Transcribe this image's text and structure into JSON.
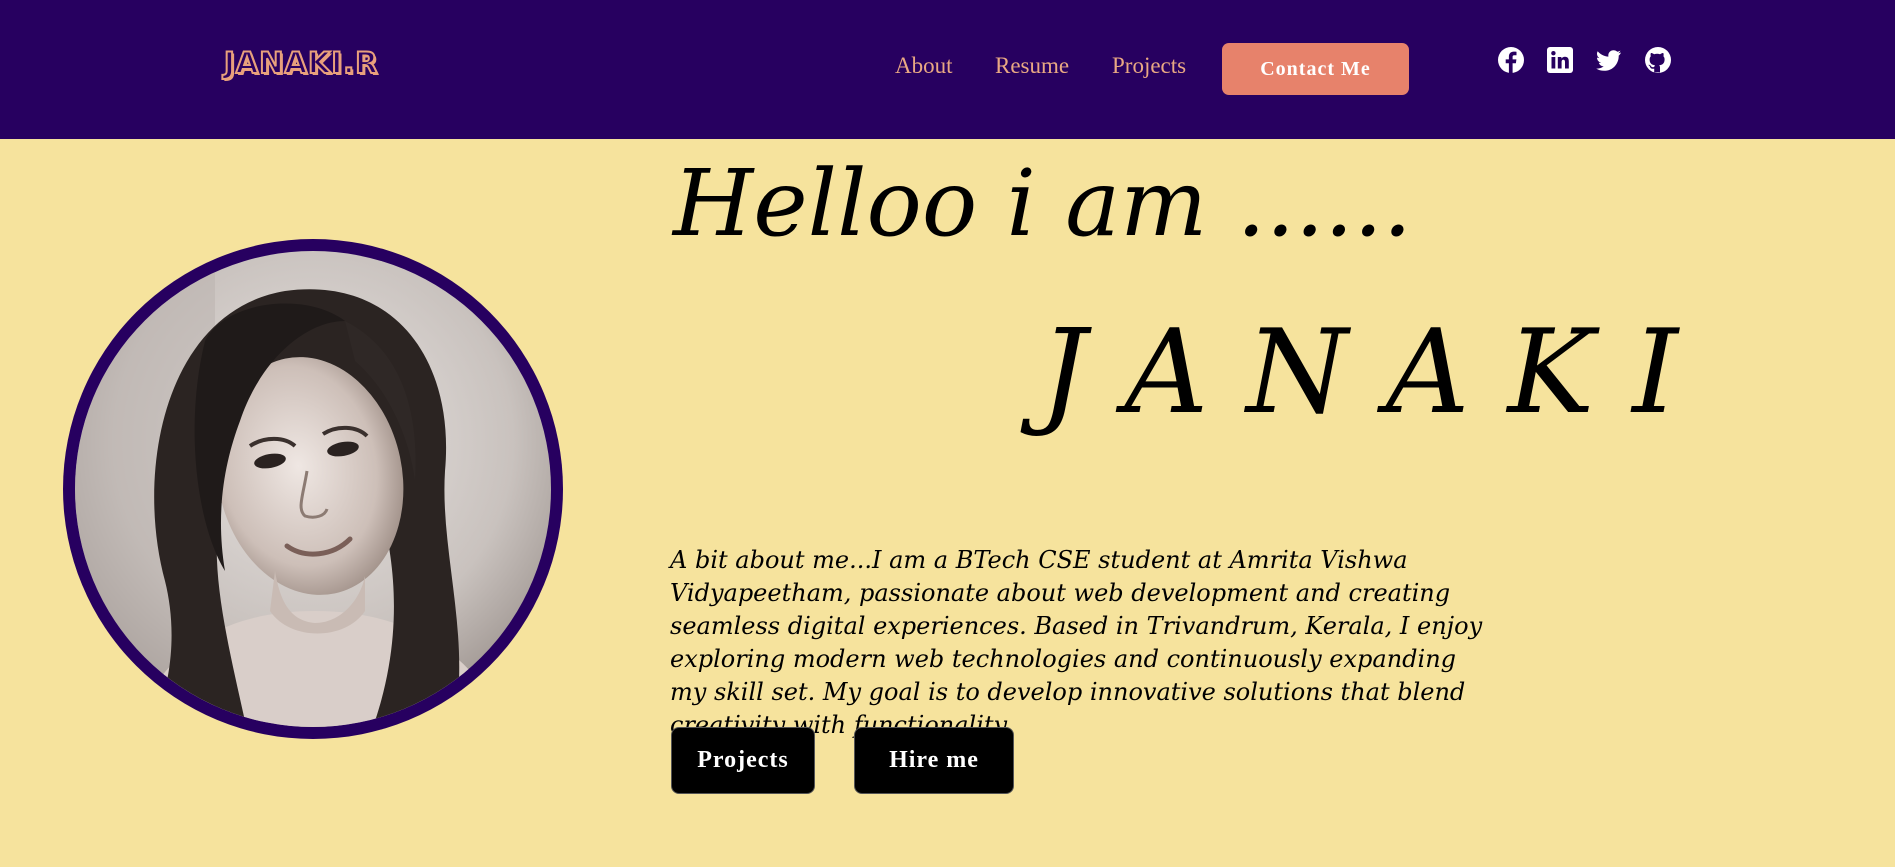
{
  "header": {
    "logo": "JANAKI.R",
    "nav": {
      "about": "About",
      "resume": "Resume",
      "projects": "Projects"
    },
    "contact_label": "Contact Me",
    "social_icons": [
      "facebook-icon",
      "linkedin-icon",
      "twitter-icon",
      "github-icon"
    ]
  },
  "hero": {
    "greeting": "Helloo i am ......",
    "name": "JANAKI",
    "bio": "A bit about me...I am a BTech CSE student at Amrita Vishwa Vidyapeetham, passionate about web development and creating seamless digital experiences. Based in Trivandrum, Kerala, I enjoy exploring modern web technologies and continuously expanding my skill set. My goal is to develop innovative solutions that blend creativity with functionality.",
    "buttons": {
      "projects": "Projects",
      "hire": "Hire me"
    }
  },
  "colors": {
    "navbar": "#270060",
    "background": "#f6e39d",
    "accent": "#e7826b",
    "nav_text": "#e9a883"
  }
}
